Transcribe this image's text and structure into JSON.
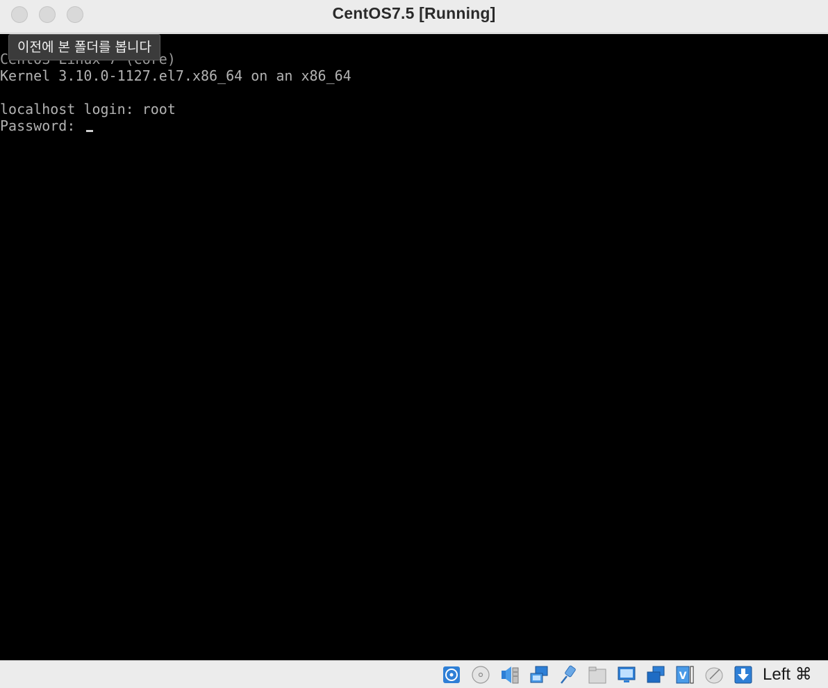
{
  "window": {
    "title": "CentOS7.5 [Running]"
  },
  "console": {
    "lines": [
      "CentOS Linux 7 (Core)",
      "Kernel 3.10.0-1127.el7.x86_64 on an x86_64",
      "localhost login: root",
      "Password: "
    ],
    "text_color": "#b3b3b3",
    "background": "#000000"
  },
  "tooltip": {
    "text": "이전에 본 폴더를 봅니다"
  },
  "statusbar": {
    "icons": [
      "hard-disk-icon",
      "optical-drive-icon",
      "audio-icon",
      "network-icon",
      "usb-icon",
      "shared-folders-icon",
      "display-icon",
      "recording-icon",
      "cpu-icon",
      "mouse-integration-icon",
      "keyboard-capture-icon"
    ],
    "host_key": "Left ⌘",
    "accent": "#1e6fd0"
  }
}
